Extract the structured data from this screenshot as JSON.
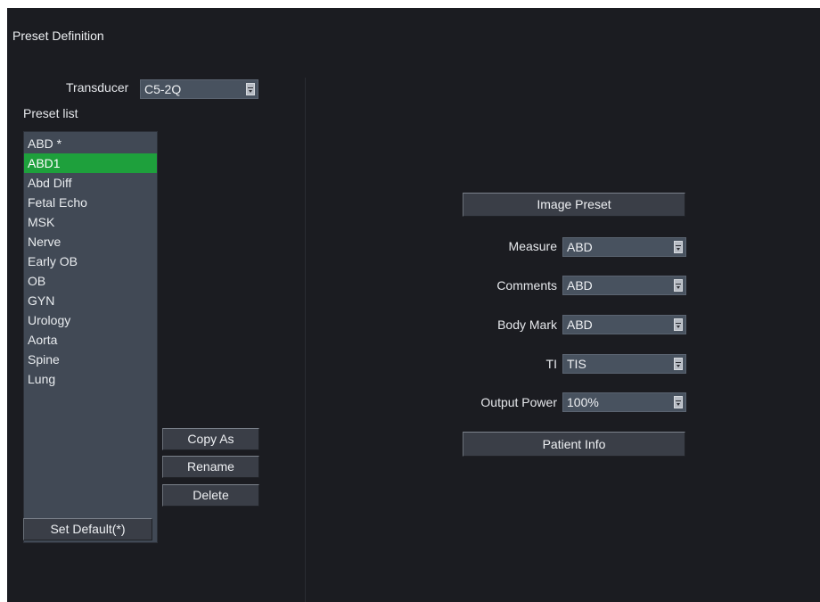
{
  "window": {
    "title": "Preset Definition"
  },
  "transducer": {
    "label": "Transducer",
    "value": "C5-2Q"
  },
  "preset_list": {
    "label": "Preset  list",
    "items": [
      "ABD *",
      "ABD1",
      "Abd Diff",
      "Fetal Echo",
      "MSK",
      "Nerve",
      "Early OB",
      "OB",
      "GYN",
      "Urology",
      "Aorta",
      "Spine",
      "Lung"
    ],
    "selected_index": 1
  },
  "list_buttons": {
    "copy_as": "Copy As",
    "rename": "Rename",
    "delete": "Delete",
    "set_default": "Set Default(*)"
  },
  "settings": {
    "image_preset": "Image Preset",
    "measure": {
      "label": "Measure",
      "value": "ABD"
    },
    "comments": {
      "label": "Comments",
      "value": "ABD"
    },
    "body_mark": {
      "label": "Body Mark",
      "value": "ABD"
    },
    "ti": {
      "label": "TI",
      "value": "TIS"
    },
    "output_power": {
      "label": "Output Power",
      "value": "100%"
    },
    "patient_info": "Patient Info"
  },
  "colors": {
    "background": "#1b1c21",
    "selection": "#1ea03c",
    "field": "#48525f",
    "list": "#414955"
  }
}
